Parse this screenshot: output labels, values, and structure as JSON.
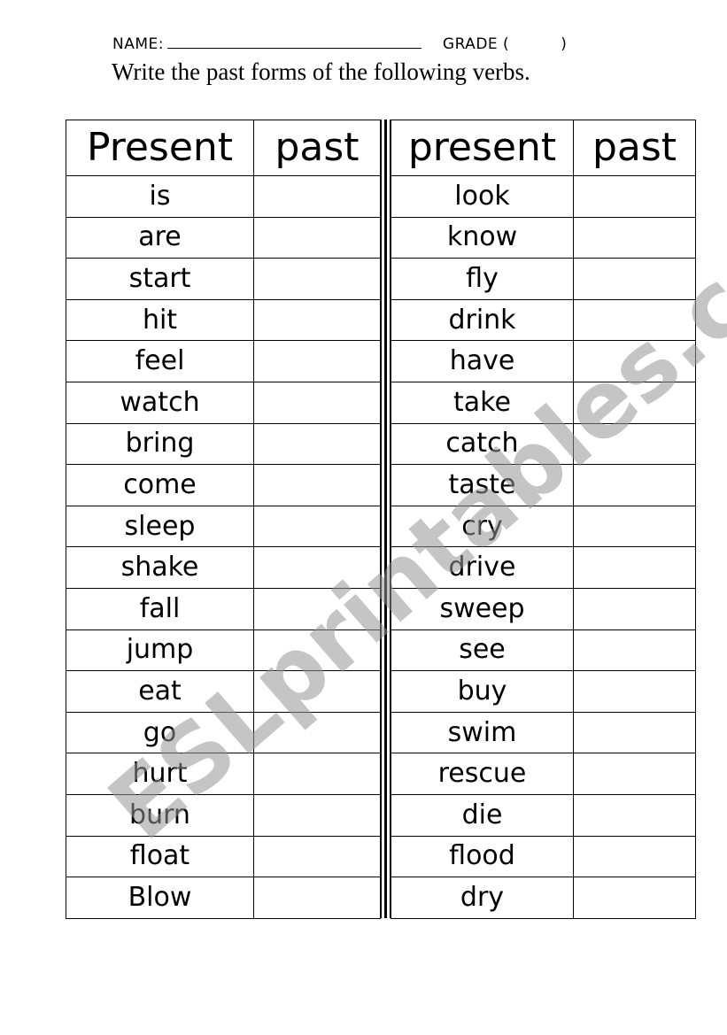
{
  "header": {
    "name_label": "NAME:",
    "grade_label": "GRADE  (",
    "grade_close": ")",
    "instruction": "Write the past forms of the following verbs."
  },
  "left_table": {
    "columns": [
      "Present",
      "past"
    ],
    "rows": [
      "is",
      "are",
      "start",
      "hit",
      "feel",
      "watch",
      "bring",
      "come",
      "sleep",
      "shake",
      "fall",
      "jump",
      "eat",
      "go",
      "hurt",
      "burn",
      "float",
      "Blow"
    ]
  },
  "right_table": {
    "columns": [
      "present",
      "past"
    ],
    "rows": [
      "look",
      "know",
      "fly",
      "drink",
      "have",
      "take",
      "catch",
      "taste",
      "cry",
      "drive",
      "sweep",
      "see",
      "buy",
      "swim",
      "rescue",
      "die",
      "flood",
      "dry"
    ]
  },
  "watermark": "ESLprintables.com"
}
